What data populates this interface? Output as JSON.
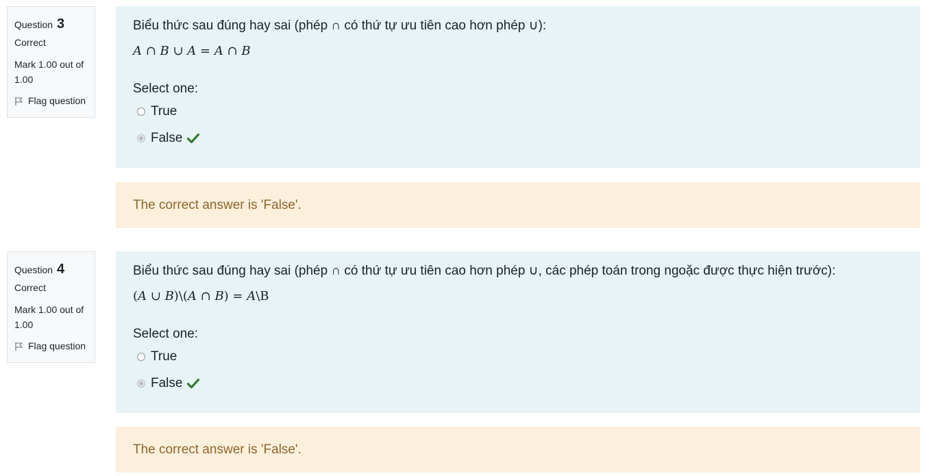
{
  "questions": [
    {
      "label": "Question",
      "number": "3",
      "state": "Correct",
      "grade": "Mark 1.00 out of 1.00",
      "flag_label": "Flag question",
      "text": "Biểu thức sau đúng hay sai (phép ∩ có thứ tự ưu tiên cao hơn phép ∪):",
      "expression": [
        "A",
        " ∩ ",
        "B",
        " ∪ ",
        "A",
        " = ",
        "A",
        " ∩ ",
        "B"
      ],
      "prompt": "Select one:",
      "options": [
        {
          "label": "True",
          "selected": false,
          "correct_mark": false
        },
        {
          "label": "False",
          "selected": true,
          "correct_mark": true
        }
      ],
      "feedback": "The correct answer is 'False'."
    },
    {
      "label": "Question",
      "number": "4",
      "state": "Correct",
      "grade": "Mark 1.00 out of 1.00",
      "flag_label": "Flag question",
      "text": "Biểu thức sau đúng hay sai (phép ∩ có thứ tự ưu tiên cao hơn phép ∪, các phép toán trong ngoặc được thực hiện trước):",
      "expression": [
        "(",
        "A",
        " ∪ ",
        "B",
        ")\\(",
        "A",
        " ∩ ",
        "B",
        ") = ",
        "A",
        "\\B"
      ],
      "prompt": "Select one:",
      "options": [
        {
          "label": "True",
          "selected": false,
          "correct_mark": false
        },
        {
          "label": "False",
          "selected": true,
          "correct_mark": true
        }
      ],
      "feedback": "The correct answer is 'False'."
    }
  ],
  "colors": {
    "formulation_bg": "#e7f3f5",
    "feedback_bg": "#fcefdc",
    "feedback_text": "#8e662e",
    "check": "#357a32",
    "info_bg": "#f8f9fa"
  },
  "icons": {
    "flag": "flag-icon",
    "check": "check-icon"
  }
}
